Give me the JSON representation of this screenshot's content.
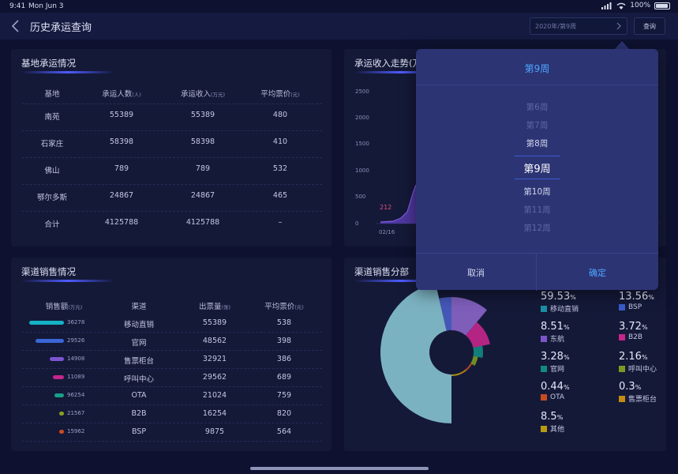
{
  "status_bar": {
    "time": "9:41",
    "date": "Mon Jun 3",
    "battery": "100%"
  },
  "nav": {
    "title": "历史承运查询",
    "week_value": "2020年/第9周",
    "query_label": "查询"
  },
  "base_panel": {
    "title": "基地承运情况",
    "headers": [
      {
        "main": "基地",
        "unit": ""
      },
      {
        "main": "承运人数",
        "unit": "(人)"
      },
      {
        "main": "承运收入",
        "unit": "(万元)"
      },
      {
        "main": "平均票价",
        "unit": "(元)"
      }
    ],
    "rows": [
      [
        "南苑",
        "55389",
        "55389",
        "480"
      ],
      [
        "石家庄",
        "58398",
        "58398",
        "410"
      ],
      [
        "佛山",
        "789",
        "789",
        "532"
      ],
      [
        "鄂尔多斯",
        "24867",
        "24867",
        "465"
      ],
      [
        "合计",
        "4125788",
        "4125788",
        "–"
      ]
    ]
  },
  "income_panel": {
    "title": "承运收入走势(万元)",
    "y_ticks": [
      "2500",
      "2000",
      "1500",
      "1000",
      "500",
      "0"
    ],
    "x_tick": "02/16",
    "point_label": "212"
  },
  "channel_panel": {
    "title": "渠道销售情况",
    "headers": [
      {
        "main": "销售额",
        "unit": "(万元)"
      },
      {
        "main": "渠道",
        "unit": ""
      },
      {
        "main": "出票量",
        "unit": "(张)"
      },
      {
        "main": "平均票价",
        "unit": "(元)"
      }
    ],
    "rows": [
      {
        "sales": "36278",
        "channel": "移动直销",
        "tickets": "55389",
        "avg": "538",
        "color": "#14b2c4",
        "bar": 1.0
      },
      {
        "sales": "29526",
        "channel": "官网",
        "tickets": "48562",
        "avg": "398",
        "color": "#3a66d8",
        "bar": 0.81
      },
      {
        "sales": "14908",
        "channel": "售票柜台",
        "tickets": "32921",
        "avg": "386",
        "color": "#7b55d0",
        "bar": 0.41
      },
      {
        "sales": "11089",
        "channel": "呼叫中心",
        "tickets": "29562",
        "avg": "689",
        "color": "#c4268c",
        "bar": 0.31
      },
      {
        "sales": "96254",
        "channel": "OTA",
        "tickets": "21024",
        "avg": "759",
        "color": "#18a088",
        "bar": 0.27
      },
      {
        "sales": "21567",
        "channel": "B2B",
        "tickets": "16254",
        "avg": "820",
        "color": "#8aa020",
        "bar": 0.12
      },
      {
        "sales": "15962",
        "channel": "BSP",
        "tickets": "9875",
        "avg": "564",
        "color": "#d04a22",
        "bar": 0.06
      }
    ]
  },
  "distribution_panel": {
    "title": "渠道销售分部",
    "legend": [
      {
        "pct": "59.53",
        "name": "移动直销",
        "color": "#1a8fa4"
      },
      {
        "pct": "13.56",
        "name": "BSP",
        "color": "#3a5cc8"
      },
      {
        "pct": "8.51",
        "name": "东航",
        "color": "#7b55c8"
      },
      {
        "pct": "3.72",
        "name": "B2B",
        "color": "#c4268c"
      },
      {
        "pct": "3.28",
        "name": "官网",
        "color": "#128a82"
      },
      {
        "pct": "2.16",
        "name": "呼叫中心",
        "color": "#7a9a20"
      },
      {
        "pct": "0.44",
        "name": "OTA",
        "color": "#c84a1e"
      },
      {
        "pct": "0.3",
        "name": "售票柜台",
        "color": "#c48a12"
      },
      {
        "pct": "8.5",
        "name": "其他",
        "color": "#b89a10"
      }
    ],
    "pct_unit": "%"
  },
  "picker": {
    "header": "第9周",
    "options": [
      "第6周",
      "第7周",
      "第8周",
      "第9周",
      "第10周",
      "第11周",
      "第12周"
    ],
    "selected_index": 3,
    "cancel": "取消",
    "confirm": "确定"
  }
}
